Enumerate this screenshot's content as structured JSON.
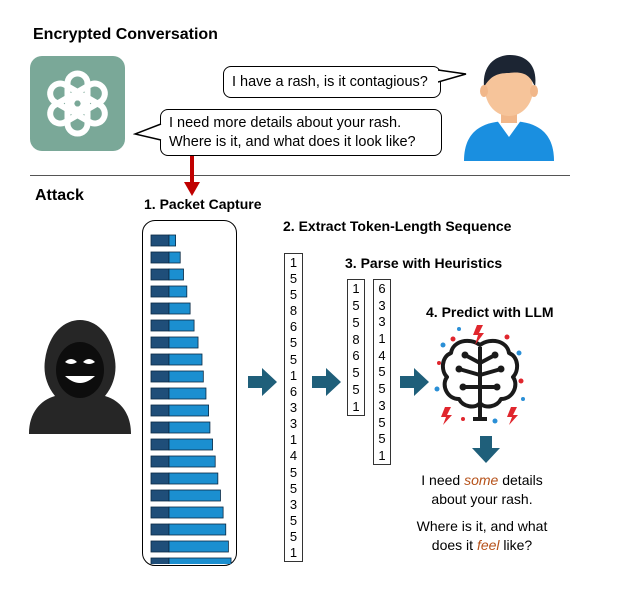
{
  "header": {
    "title": "Encrypted Conversation"
  },
  "conversation": {
    "user_message": "I have a rash, is it contagious?",
    "assistant_message_line1": "I need more details about your rash.",
    "assistant_message_line2": "Where is it, and what does it look like?"
  },
  "attack": {
    "title": "Attack",
    "steps": [
      {
        "label": "1. Packet Capture"
      },
      {
        "label": "2. Extract Token-Length Sequence"
      },
      {
        "label": "3. Parse with Heuristics"
      },
      {
        "label": "4. Predict with LLM"
      }
    ]
  },
  "packets": {
    "count": 20,
    "payload_relative_widths": [
      0.1,
      0.17,
      0.22,
      0.27,
      0.32,
      0.38,
      0.44,
      0.5,
      0.52,
      0.56,
      0.6,
      0.62,
      0.66,
      0.7,
      0.74,
      0.78,
      0.82,
      0.86,
      0.9,
      0.94
    ]
  },
  "token_lengths": [
    "1",
    "5",
    "5",
    "8",
    "6",
    "5",
    "5",
    "1",
    "6",
    "3",
    "3",
    "1",
    "4",
    "5",
    "5",
    "3",
    "5",
    "5",
    "1"
  ],
  "parsed": {
    "segment1": [
      "1",
      "5",
      "5",
      "8",
      "6",
      "5",
      "5",
      "1"
    ],
    "segment2": [
      "6",
      "3",
      "3",
      "1",
      "4",
      "5",
      "5",
      "3",
      "5",
      "5",
      "1"
    ]
  },
  "prediction": {
    "line1_a": "I need ",
    "line1_em": "some",
    "line1_b": " details",
    "line2": "about your rash.",
    "line3": "Where is it, and what",
    "line4_a": "does it ",
    "line4_em": "feel",
    "line4_b": " like?"
  },
  "colors": {
    "chatbot_tile": "#7aa898",
    "packet_dark": "#1f4e79",
    "packet_light": "#1b8fd0",
    "flow_arrow": "#1f5f7a",
    "attack_arrow": "#c00000",
    "emphasis": "#b6521a"
  },
  "icons": [
    "openai-logo-icon",
    "user-avatar-icon",
    "hacker-icon",
    "brain-circuit-icon"
  ]
}
